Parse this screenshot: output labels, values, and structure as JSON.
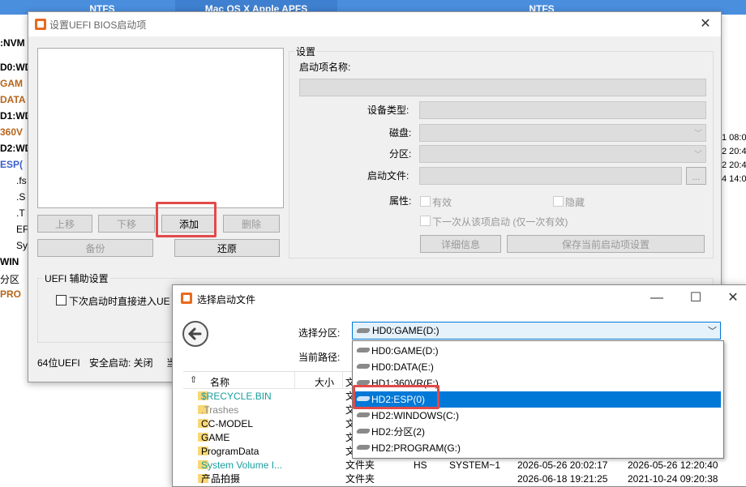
{
  "bg": {
    "top_parts": [
      "NTFS",
      "Mac OS X Apple APFS",
      "NTFS"
    ],
    "left_labels": [
      ":NVM",
      "D0:WD",
      "GAM",
      "DATA",
      "D1:WD",
      "360V",
      "D2:WD",
      "ESP(",
      ".fs",
      ".S",
      ".T",
      "EF",
      "Sy",
      "WIN",
      "分区",
      "PRO"
    ],
    "right_labels": [
      "1 08:0",
      "2 20:4",
      "2 20:4",
      "4 14:0"
    ]
  },
  "dlg1": {
    "title": "设置UEFI BIOS启动项",
    "settings_label": "设置",
    "boot_name_label": "启动项名称:",
    "device_type_label": "设备类型:",
    "disk_label": "磁盘:",
    "partition_label": "分区:",
    "boot_file_label": "启动文件:",
    "browse_label": "...",
    "attr_label": "属性:",
    "valid_label": "有效",
    "hidden_label": "隐藏",
    "next_boot_label": "下一次从该项启动 (仅一次有效)",
    "detail_btn": "详细信息",
    "save_btn": "保存当前启动项设置",
    "up_btn": "上移",
    "down_btn": "下移",
    "add_btn": "添加",
    "delete_btn": "删除",
    "backup_btn": "备份",
    "restore_btn": "还原",
    "uefi_group": "UEFI 辅助设置",
    "uefi_check": "下次启动时直接进入UE",
    "status_bits": "64位UEFI",
    "status_secure": "安全启动: 关闭",
    "status_more": "当"
  },
  "dlg2": {
    "title": "选择启动文件",
    "partition_label": "选择分区:",
    "partition_value": "HD0:GAME(D:)",
    "path_label": "当前路径:",
    "col_name": "名称",
    "col_size": "大小",
    "col_type": "文",
    "files": [
      {
        "name": "$RECYCLE.BIN",
        "type": "文",
        "attr": "",
        "short": "",
        "created": "",
        "modified": ""
      },
      {
        "name": ".Trashes",
        "type": "文",
        "attr": "",
        "short": "",
        "created": "",
        "modified": ""
      },
      {
        "name": "CC-MODEL",
        "type": "文",
        "attr": "",
        "short": "",
        "created": "",
        "modified": ""
      },
      {
        "name": "GAME",
        "type": "文",
        "attr": "",
        "short": "",
        "created": "",
        "modified": ""
      },
      {
        "name": "ProgramData",
        "type": "文",
        "attr": "",
        "short": "",
        "created": "",
        "modified": ""
      },
      {
        "name": "System Volume I...",
        "type": "文件夹",
        "attr": "HS",
        "short": "SYSTEM~1",
        "created": "2026-05-26 20:02:17",
        "modified": "2026-05-26 12:20:40"
      },
      {
        "name": "产品拍摄",
        "type": "文件夹",
        "attr": "",
        "short": "",
        "created": "2026-06-18 19:21:25",
        "modified": "2021-10-24 09:20:38"
      }
    ],
    "dropdown": [
      {
        "label": "HD0:GAME(D:)",
        "selected": false
      },
      {
        "label": "HD0:DATA(E:)",
        "selected": false
      },
      {
        "label": "HD1:360VR(F:)",
        "selected": false
      },
      {
        "label": "HD2:ESP(0)",
        "selected": true
      },
      {
        "label": "HD2:WINDOWS(C:)",
        "selected": false
      },
      {
        "label": "HD2:分区(2)",
        "selected": false
      },
      {
        "label": "HD2:PROGRAM(G:)",
        "selected": false
      }
    ],
    "minimize": "—",
    "maximize": "☐",
    "close": "✕"
  },
  "colors": {
    "accent": "#0078d7",
    "highlight": "#e24a4a",
    "bg_bar": "#4a8ede"
  }
}
